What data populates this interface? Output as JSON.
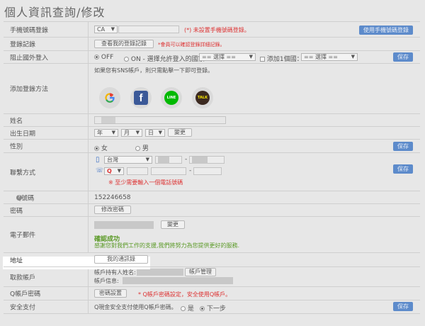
{
  "page_title": "個人資訊查詢/修改",
  "colors": {
    "accent_blue": "#5d8bcb",
    "error_red": "#dd3333",
    "success_green": "#5b9a27"
  },
  "phone_login": {
    "label": "手機號碼登錄",
    "country": "CA",
    "warning": "(*) 未設置手機號碼登錄。",
    "button": "使用手機號碼登錄"
  },
  "login_record": {
    "label": "登錄記錄",
    "button": "查看我的登錄記錄",
    "note": "*會員可以確認登錄詳細記錄。"
  },
  "block_overseas": {
    "label": "阻止國外登入",
    "off": "OFF",
    "on": "ON - 選擇允許登入的國家:",
    "select1": "== 選擇 ==",
    "add_label": "添加1個國：",
    "select2": "== 選擇 ==",
    "save": "保存"
  },
  "add_login": {
    "label": "添加登錄方法",
    "hint": "如果您有SNS帳戶，則只需點擊一下即可登錄。",
    "icons": [
      "google-icon",
      "facebook-icon",
      "line-icon",
      "kakaotalk-icon"
    ],
    "facebook_glyph": "f",
    "line_glyph": "LINE",
    "talk_glyph": "TALK"
  },
  "name": {
    "label": "姓名"
  },
  "birth": {
    "label": "出生日期",
    "year": "年",
    "month": "月",
    "day": "日",
    "button": "變更"
  },
  "gender": {
    "label": "性別",
    "female": "女",
    "male": "男",
    "save": "保存"
  },
  "contact": {
    "label": "聯繫方式",
    "region": "台灣",
    "dash": "-",
    "note": "※ 至少需要輸入一個電話號碼",
    "save": "保存"
  },
  "qq": {
    "label": "Q號碼",
    "value": "152246658"
  },
  "password": {
    "label": "密碼",
    "button": "修改密碼"
  },
  "email": {
    "label": "電子郵件",
    "button": "變更",
    "status": "確認成功",
    "thanks": "感謝您對我們工作的支援,我們將努力為您提供更好的服務."
  },
  "address": {
    "label": "地址",
    "button": "我的通訊錄"
  },
  "withdraw": {
    "label": "取款帳戶",
    "holder_label": "帳戶持有人姓名:",
    "manage_button": "帳戶管理",
    "info_label": "帳戶信息:"
  },
  "q_password": {
    "label": "Q帳戶密碼",
    "button": "密碼設置",
    "warning": "* Q帳戶密碼設定，安全使用Q帳戶。"
  },
  "secure_pay": {
    "label": "安全支付",
    "question": "Q現金安全支付使用Q帳戶密碼。",
    "yes": "是",
    "next": "下一步",
    "save": "保存"
  }
}
